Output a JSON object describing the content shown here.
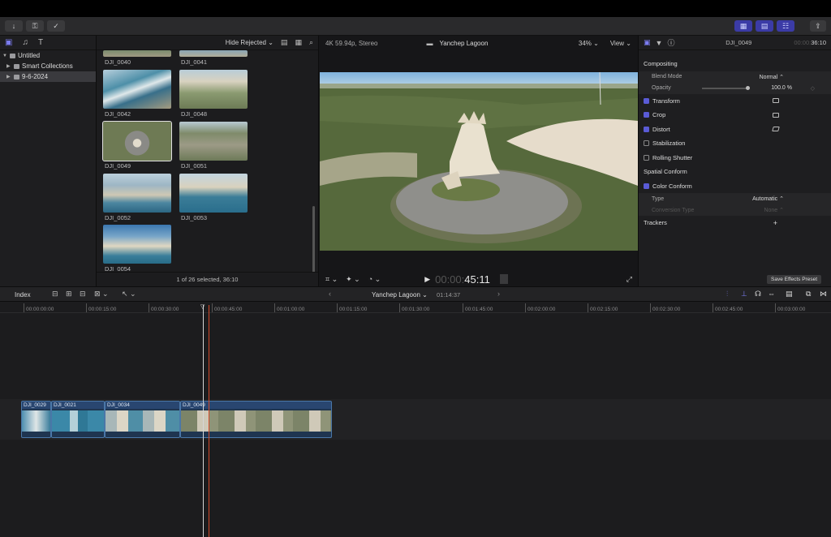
{
  "toolbar": {
    "import_icon": "download-arrow-icon",
    "keywords_icon": "key-icon",
    "analysis_icon": "checkmark-circle-icon",
    "layout_buttons": [
      "browser-layout-icon",
      "timeline-layout-icon",
      "inspector-layout-icon"
    ],
    "share_icon": "share-icon"
  },
  "sidebar": {
    "items": [
      {
        "label": "Untitled",
        "level": 0,
        "expanded": true,
        "selected": false
      },
      {
        "label": "Smart Collections",
        "level": 1,
        "expanded": false,
        "selected": false
      },
      {
        "label": "9-6-2024",
        "level": 1,
        "expanded": false,
        "selected": true
      }
    ]
  },
  "browser": {
    "filter": "Hide Rejected",
    "clips": [
      {
        "name": "DJI_0040",
        "selected": false
      },
      {
        "name": "DJI_0041",
        "selected": false
      },
      {
        "name": "DJI_0042",
        "selected": false
      },
      {
        "name": "DJI_0048",
        "selected": false
      },
      {
        "name": "DJI_0049",
        "selected": true
      },
      {
        "name": "DJI_0051",
        "selected": false
      },
      {
        "name": "DJI_0052",
        "selected": false
      },
      {
        "name": "DJI_0053",
        "selected": false
      },
      {
        "name": "DJI_0054",
        "selected": false
      }
    ],
    "footer": "1 of 26 selected, 36:10"
  },
  "viewer": {
    "format": "4K 59.94p, Stereo",
    "title": "Yanchep Lagoon",
    "zoom": "34%",
    "view_label": "View",
    "timecode_dim": "00:00:",
    "timecode": "45:11"
  },
  "inspector": {
    "clip_name": "DJI_0049",
    "duration_dim": "00:00:",
    "duration": "36:10",
    "section": "Compositing",
    "blend_mode_label": "Blend Mode",
    "blend_mode_value": "Normal",
    "opacity_label": "Opacity",
    "opacity_value": "100.0",
    "opacity_unit": "%",
    "effects": [
      {
        "label": "Transform",
        "checked": true,
        "icon": "transform-icon"
      },
      {
        "label": "Crop",
        "checked": true,
        "icon": "crop-icon"
      },
      {
        "label": "Distort",
        "checked": true,
        "icon": "distort-icon"
      },
      {
        "label": "Stabilization",
        "checked": false,
        "icon": ""
      },
      {
        "label": "Rolling Shutter",
        "checked": false,
        "icon": ""
      }
    ],
    "spatial_conform": "Spatial Conform",
    "color_conform": "Color Conform",
    "type_label": "Type",
    "type_value": "Automatic",
    "conversion_label": "Conversion Type",
    "conversion_value": "None",
    "trackers_label": "Trackers",
    "save_preset": "Save Effects Preset"
  },
  "timeline": {
    "index_label": "Index",
    "project": "Yanchep Lagoon",
    "duration": "01:14:37",
    "ruler": [
      "00:00:00:00",
      "00:00:15:00",
      "00:00:30:00",
      "00:00:45:00",
      "00:01:00:00",
      "00:01:15:00",
      "00:01:30:00",
      "00:01:45:00",
      "00:02:00:00",
      "00:02:15:00",
      "00:02:30:00",
      "00:02:45:00",
      "00:03:00:00"
    ],
    "clips": [
      {
        "name": "DJI_0029"
      },
      {
        "name": "DJI_0021"
      },
      {
        "name": "DJI_0034"
      },
      {
        "name": "DJI_0049"
      }
    ]
  },
  "colors": {
    "accent": "#5a5bd6",
    "clip_blue": "#1f3550",
    "playhead_red": "#d24a2a"
  }
}
